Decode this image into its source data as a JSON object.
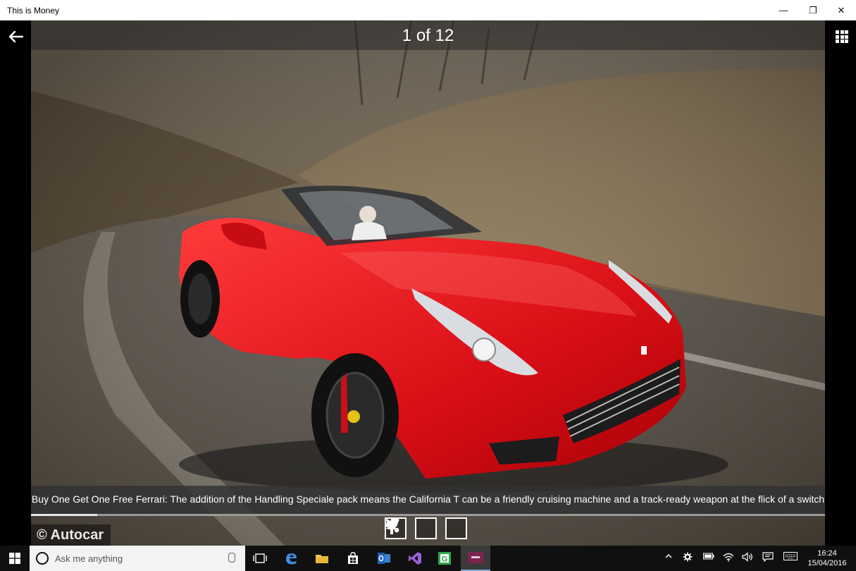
{
  "window": {
    "title": "This is Money",
    "minimize_glyph": "—",
    "maximize_glyph": "❐",
    "close_glyph": "✕"
  },
  "gallery": {
    "counter": "1 of 12",
    "caption": "Buy One Get One Free Ferrari: The addition of the Handling Speciale pack means the California T can be a friendly cruising machine and a track-ready weapon at the flick of a switch",
    "photo_credit": "© Autocar",
    "progress": 0.0833,
    "share_buttons": [
      {
        "icon": "facebook-icon"
      },
      {
        "icon": "twitter-icon"
      },
      {
        "icon": "share-icon"
      }
    ]
  },
  "taskbar": {
    "search_placeholder": "Ask me anything",
    "apps": [
      "task-view-icon",
      "edge-icon",
      "file-explorer-icon",
      "store-icon",
      "outlook-icon",
      "visual-studio-icon",
      "app-g-icon",
      "this-is-money-icon"
    ],
    "time": "16:24",
    "date": "15/04/2016"
  },
  "colors": {
    "car_red": "#e0151b",
    "taskbar_bg": "#101010",
    "caption_bg": "#323232"
  }
}
